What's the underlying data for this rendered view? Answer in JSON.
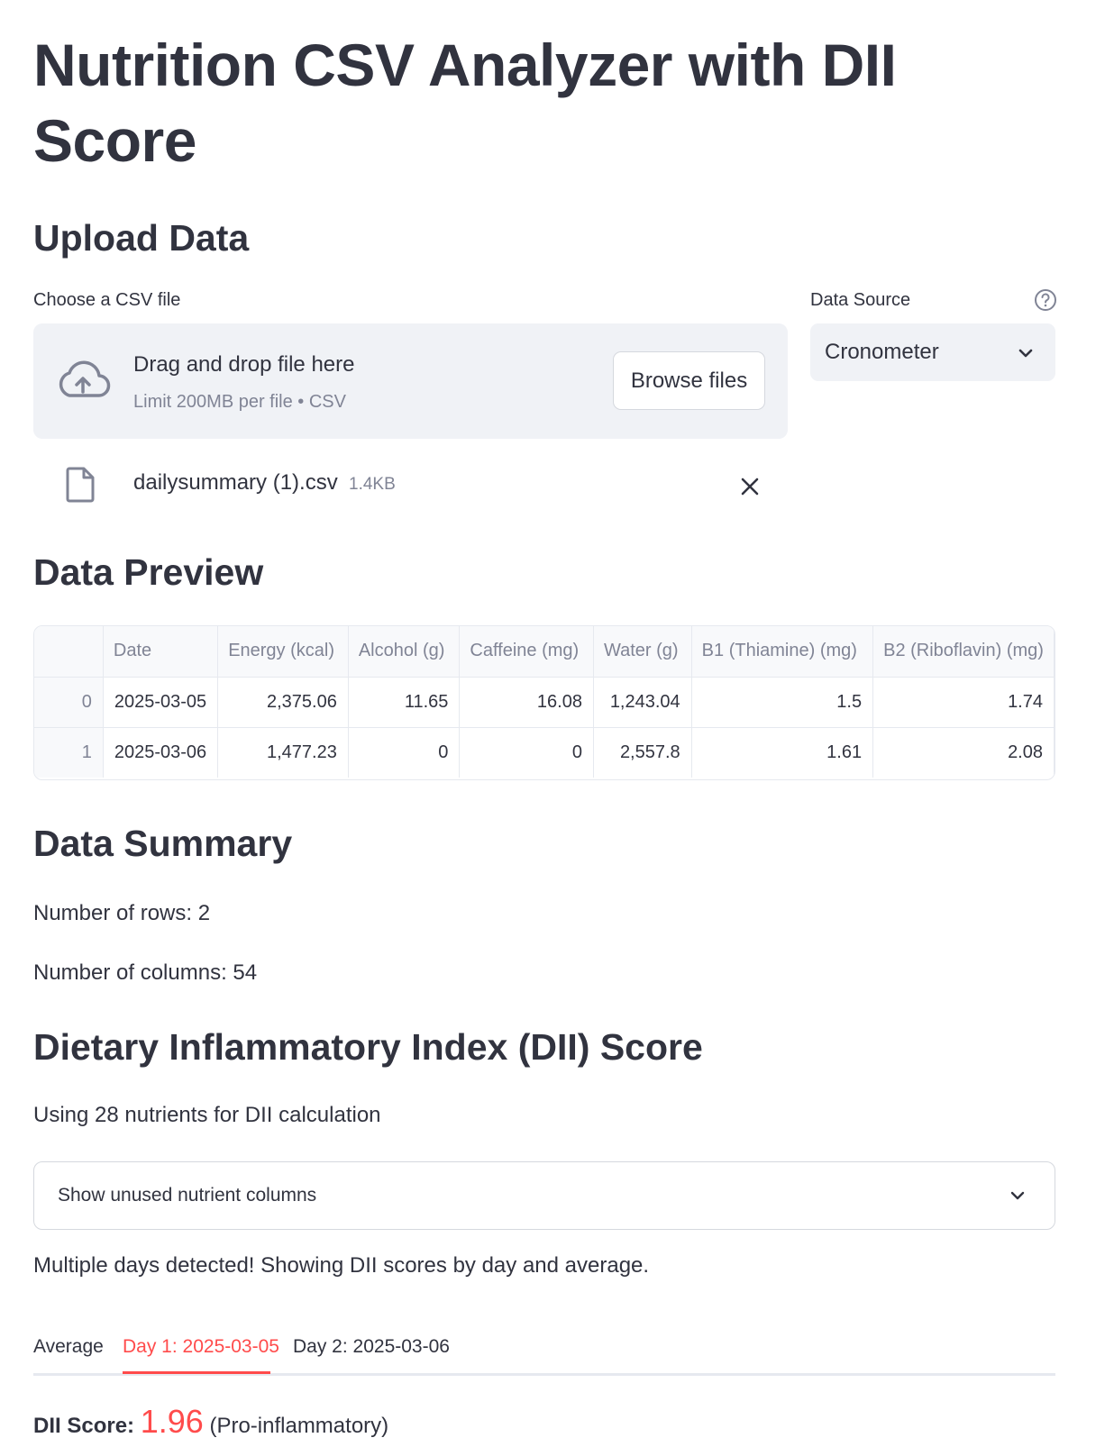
{
  "title": "Nutrition CSV Analyzer with DII Score",
  "upload": {
    "heading": "Upload Data",
    "file_label": "Choose a CSV file",
    "drop_title": "Drag and drop file here",
    "drop_limit": "Limit 200MB per file • CSV",
    "browse_label": "Browse files",
    "file_name": "dailysummary (1).csv",
    "file_size": "1.4KB"
  },
  "data_source": {
    "label": "Data Source",
    "value": "Cronometer"
  },
  "preview": {
    "heading": "Data Preview",
    "columns": [
      "",
      "Date",
      "Energy (kcal)",
      "Alcohol (g)",
      "Caffeine (mg)",
      "Water (g)",
      "B1 (Thiamine) (mg)",
      "B2 (Riboflavin) (mg)"
    ],
    "rows": [
      [
        "0",
        "2025-03-05",
        "2,375.06",
        "11.65",
        "16.08",
        "1,243.04",
        "1.5",
        "1.74"
      ],
      [
        "1",
        "2025-03-06",
        "1,477.23",
        "0",
        "0",
        "2,557.8",
        "1.61",
        "2.08"
      ]
    ]
  },
  "summary": {
    "heading": "Data Summary",
    "rows_text": "Number of rows: 2",
    "cols_text": "Number of columns: 54"
  },
  "dii": {
    "heading": "Dietary Inflammatory Index (DII) Score",
    "using_text": "Using 28 nutrients for DII calculation",
    "expander_label": "Show unused nutrient columns",
    "multi_text": "Multiple days detected! Showing DII scores by day and average.",
    "tabs": [
      "Average",
      "Day 1: 2025-03-05",
      "Day 2: 2025-03-06"
    ],
    "active_tab": 1,
    "score_label": "DII Score:",
    "score_value": "1.96",
    "score_class": "(Pro-inflammatory)"
  },
  "colors": {
    "accent": "#ff4b4b",
    "text": "#31333f",
    "muted": "#808495",
    "panel": "#f0f2f6"
  },
  "icons": [
    "cloud-upload-icon",
    "file-icon",
    "close-icon",
    "chevron-down-icon",
    "help-icon"
  ]
}
